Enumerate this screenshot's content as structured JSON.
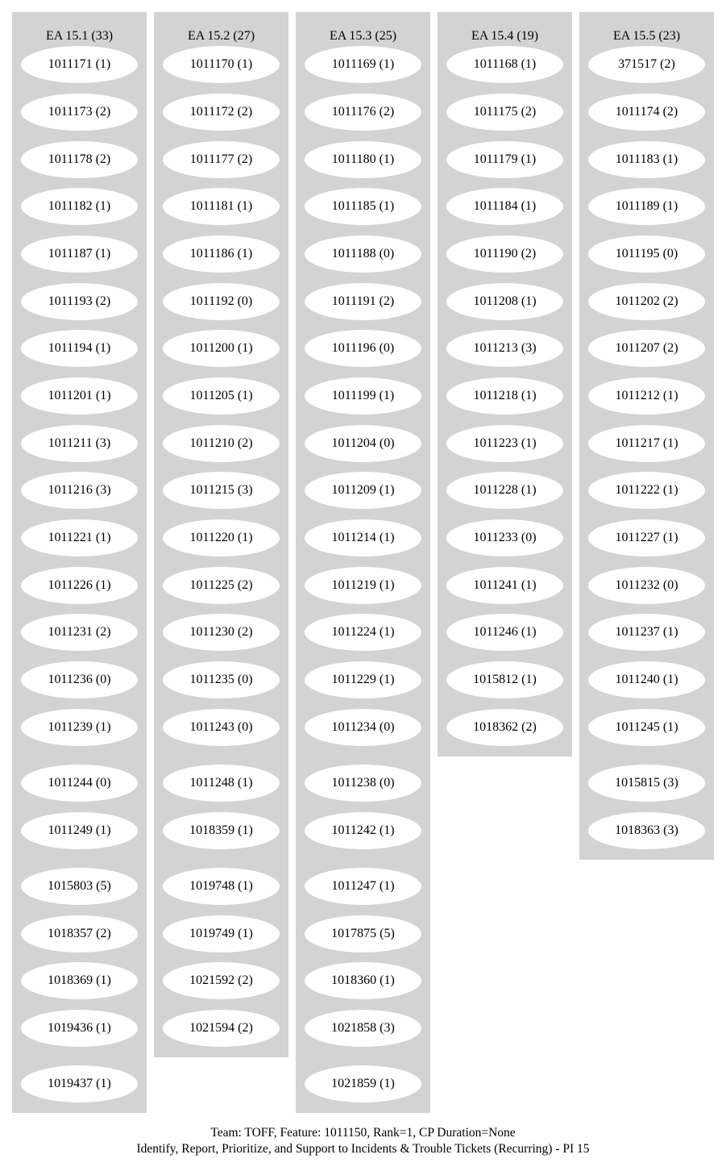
{
  "clusters": [
    {
      "title": "EA 15.1 (33)",
      "nodes": [
        "1011171 (1)",
        "1011173 (2)",
        "1011178 (2)",
        "1011182 (1)",
        "1011187 (1)",
        "1011193 (2)",
        "1011194 (1)",
        "1011201 (1)",
        "1011211 (3)",
        "1011216 (3)",
        "1011221 (1)",
        "1011226 (1)",
        "1011231 (2)",
        "1011236 (0)",
        "1011239 (1)",
        "1011244 (0)",
        "1011249 (1)",
        "1015803 (5)",
        "1018357 (2)",
        "1018369 (1)",
        "1019436 (1)",
        "1019437 (1)"
      ]
    },
    {
      "title": "EA 15.2 (27)",
      "nodes": [
        "1011170 (1)",
        "1011172 (2)",
        "1011177 (2)",
        "1011181 (1)",
        "1011186 (1)",
        "1011192 (0)",
        "1011200 (1)",
        "1011205 (1)",
        "1011210 (2)",
        "1011215 (3)",
        "1011220 (1)",
        "1011225 (2)",
        "1011230 (2)",
        "1011235 (0)",
        "1011243 (0)",
        "1011248 (1)",
        "1018359 (1)",
        "1019748 (1)",
        "1019749 (1)",
        "1021592 (2)",
        "1021594 (2)"
      ]
    },
    {
      "title": "EA 15.3 (25)",
      "nodes": [
        "1011169 (1)",
        "1011176 (2)",
        "1011180 (1)",
        "1011185 (1)",
        "1011188 (0)",
        "1011191 (2)",
        "1011196 (0)",
        "1011199 (1)",
        "1011204 (0)",
        "1011209 (1)",
        "1011214 (1)",
        "1011219 (1)",
        "1011224 (1)",
        "1011229 (1)",
        "1011234 (0)",
        "1011238 (0)",
        "1011242 (1)",
        "1011247 (1)",
        "1017875 (5)",
        "1018360 (1)",
        "1021858 (3)",
        "1021859 (1)"
      ]
    },
    {
      "title": "EA 15.4 (19)",
      "nodes": [
        "1011168 (1)",
        "1011175 (2)",
        "1011179 (1)",
        "1011184 (1)",
        "1011190 (2)",
        "1011208 (1)",
        "1011213 (3)",
        "1011218 (1)",
        "1011223 (1)",
        "1011228 (1)",
        "1011233 (0)",
        "1011241 (1)",
        "1011246 (1)",
        "1015812 (1)",
        "1018362 (2)"
      ]
    },
    {
      "title": "EA 15.5 (23)",
      "nodes": [
        "371517 (2)",
        "1011174 (2)",
        "1011183 (1)",
        "1011189 (1)",
        "1011195 (0)",
        "1011202 (2)",
        "1011207 (2)",
        "1011212 (1)",
        "1011217 (1)",
        "1011222 (1)",
        "1011227 (1)",
        "1011232 (0)",
        "1011237 (1)",
        "1011240 (1)",
        "1011245 (1)",
        "1015815 (3)",
        "1018363 (3)"
      ]
    }
  ],
  "caption": {
    "line1": "Team: TOFF, Feature: 1011150, Rank=1, CP Duration=None",
    "line2": "Identify, Report, Prioritize, and Support to Incidents & Trouble Tickets (Recurring) - PI 15"
  }
}
